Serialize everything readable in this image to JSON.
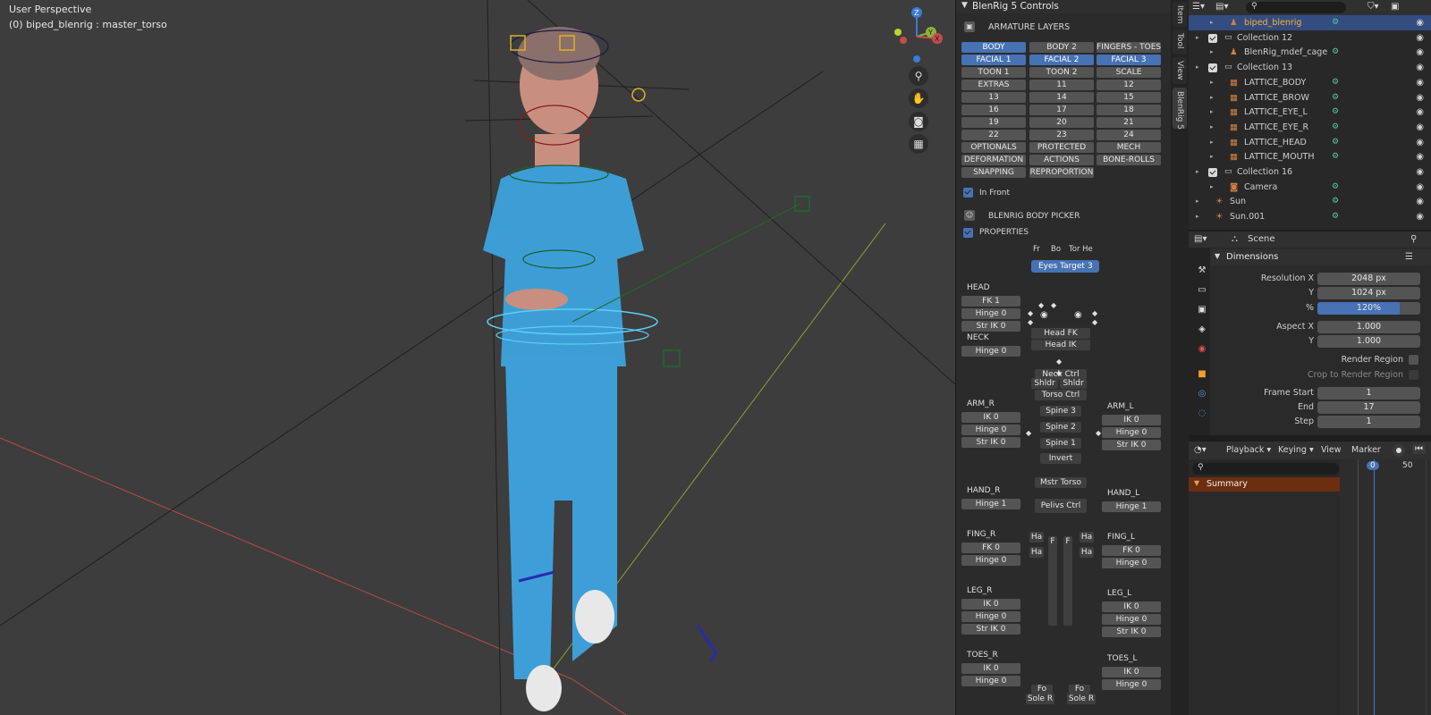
{
  "viewport": {
    "perspective_label": "User Perspective",
    "active_object_label": "(0) biped_blenrig : master_torso",
    "gizmo": {
      "z": "Z",
      "y": "Y",
      "x": "X"
    },
    "nav_icons": [
      "zoom-icon",
      "hand-pan-icon",
      "camera-icon",
      "grid-icon"
    ],
    "colors": {
      "background": "#3d3d3d",
      "x_axis": "#c94b4b",
      "y_axis": "#8bb33a"
    }
  },
  "npanel": {
    "title": "BlenRig 5 Controls",
    "armature_layers_title": "ARMATURE LAYERS",
    "layers": [
      [
        "BODY",
        "BODY 2",
        "FINGERS - TOES"
      ],
      [
        "FACIAL 1",
        "FACIAL 2",
        "FACIAL 3"
      ],
      [
        "TOON 1",
        "TOON 2",
        "SCALE"
      ],
      [
        "EXTRAS",
        "11",
        "12"
      ],
      [
        "13",
        "14",
        "15"
      ],
      [
        "16",
        "17",
        "18"
      ],
      [
        "19",
        "20",
        "21"
      ],
      [
        "22",
        "23",
        "24"
      ],
      [
        "OPTIONALS",
        "PROTECTED",
        "MECH"
      ],
      [
        "DEFORMATION",
        "ACTIONS",
        "BONE-ROLLS"
      ],
      [
        "SNAPPING",
        "REPROPORTION",
        ""
      ]
    ],
    "layers_active": [
      [
        true,
        false,
        false
      ],
      [
        true,
        true,
        true
      ]
    ],
    "in_front_label": "In Front",
    "body_picker_title": "BLENRIG BODY PICKER",
    "properties_label": "PROPERTIES",
    "fr_bo_tor": [
      "Fr",
      "Bo",
      "Tor He"
    ],
    "eyes_target_label": "Eyes Target",
    "eyes_target_value": "3",
    "head": {
      "label": "HEAD",
      "buttons": [
        "FK 1",
        "Hinge 0",
        "Str IK 0"
      ]
    },
    "neck": {
      "label": "NECK",
      "buttons": [
        "Hinge 0"
      ]
    },
    "arm_r": {
      "label": "ARM_R",
      "buttons": [
        "IK 0",
        "Hinge 0",
        "Str IK 0"
      ]
    },
    "arm_l": {
      "label": "ARM_L",
      "buttons": [
        "IK 0",
        "Hinge 0",
        "Str IK 0"
      ]
    },
    "hand_r": {
      "label": "HAND_R",
      "buttons": [
        "Hinge 1"
      ]
    },
    "hand_l": {
      "label": "HAND_L",
      "buttons": [
        "Hinge 1"
      ]
    },
    "fing_r": {
      "label": "FING_R",
      "buttons": [
        "FK 0",
        "Hinge 0"
      ]
    },
    "fing_l": {
      "label": "FING_L",
      "buttons": [
        "FK 0",
        "Hinge 0"
      ]
    },
    "leg_r": {
      "label": "LEG_R",
      "buttons": [
        "IK 0",
        "Hinge 0",
        "Str IK 0"
      ]
    },
    "leg_l": {
      "label": "LEG_L",
      "buttons": [
        "IK 0",
        "Hinge 0",
        "Str IK 0"
      ]
    },
    "toes_r": {
      "label": "TOES_R",
      "buttons": [
        "IK 0",
        "Hinge 0"
      ]
    },
    "toes_l": {
      "label": "TOES_L",
      "buttons": [
        "IK 0",
        "Hinge 0"
      ]
    },
    "picker": {
      "head_fk": "Head FK",
      "head_ik": "Head IK",
      "neck_ctrl": "Neck Ctrl",
      "shldr_r": "Shldr",
      "shldr_l": "Shldr",
      "torso_ctrl": "Torso Ctrl",
      "spine3": "Spine 3",
      "spine2": "Spine 2",
      "spine1": "Spine 1",
      "invert": "Invert",
      "mstr_torso": "Mstr Torso",
      "pelvis_ctrl": "Pelivs Ctrl",
      "ha": "Ha",
      "f": "F",
      "fo": "Fo",
      "sole_r": "Sole R"
    }
  },
  "ntabs": [
    "Item",
    "Tool",
    "View",
    "BlenRig 5"
  ],
  "outliner": {
    "search_placeholder": "",
    "rows": [
      {
        "name": "biped_blenrig",
        "indent": 3,
        "selected": true,
        "check": false
      },
      {
        "name": "Collection 12",
        "indent": 1,
        "selected": false,
        "check": true
      },
      {
        "name": "BlenRig_mdef_cage",
        "indent": 3,
        "selected": false,
        "check": false
      },
      {
        "name": "Collection 13",
        "indent": 1,
        "selected": false,
        "check": true
      },
      {
        "name": "LATTICE_BODY",
        "indent": 3,
        "selected": false,
        "check": false
      },
      {
        "name": "LATTICE_BROW",
        "indent": 3,
        "selected": false,
        "check": false
      },
      {
        "name": "LATTICE_EYE_L",
        "indent": 3,
        "selected": false,
        "check": false
      },
      {
        "name": "LATTICE_EYE_R",
        "indent": 3,
        "selected": false,
        "check": false
      },
      {
        "name": "LATTICE_HEAD",
        "indent": 3,
        "selected": false,
        "check": false
      },
      {
        "name": "LATTICE_MOUTH",
        "indent": 3,
        "selected": false,
        "check": false
      },
      {
        "name": "Collection 16",
        "indent": 1,
        "selected": false,
        "check": true
      },
      {
        "name": "Camera",
        "indent": 3,
        "selected": false,
        "check": false
      },
      {
        "name": "Sun",
        "indent": 1,
        "selected": false,
        "check": false
      },
      {
        "name": "Sun.001",
        "indent": 1,
        "selected": false,
        "check": false
      }
    ]
  },
  "properties": {
    "context": "Scene",
    "section": "Dimensions",
    "resolution_x_label": "Resolution X",
    "resolution_x": "2048 px",
    "resolution_y_label": "Y",
    "resolution_y": "1024 px",
    "percent_label": "%",
    "percent": "120%",
    "percent_fraction": 1.2,
    "aspect_x_label": "Aspect X",
    "aspect_x": "1.000",
    "aspect_y_label": "Y",
    "aspect_y": "1.000",
    "render_region_label": "Render Region",
    "crop_label": "Crop to Render Region",
    "frame_start_label": "Frame Start",
    "frame_start": "1",
    "end_label": "End",
    "end": "17",
    "step_label": "Step",
    "step": "1"
  },
  "timeline": {
    "playback": "Playback",
    "keying": "Keying",
    "view": "View",
    "marker": "Marker",
    "current_frame": "0",
    "frame_50": "50",
    "summary": "Summary"
  }
}
